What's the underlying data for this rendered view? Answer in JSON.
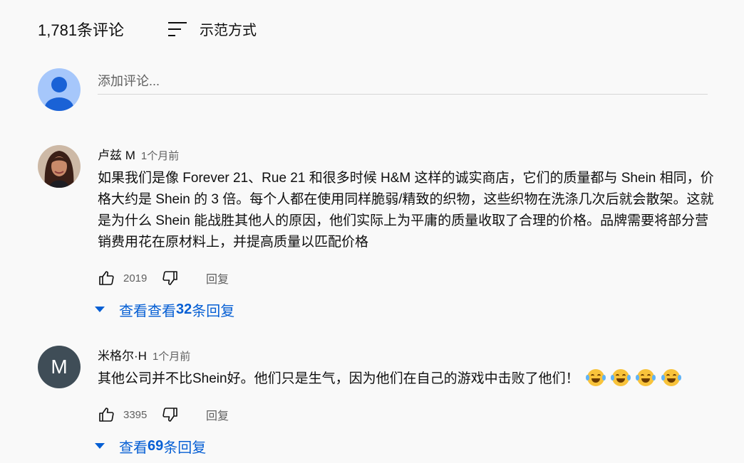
{
  "header": {
    "comment_count": "1,781条评论",
    "sort_label": "示范方式"
  },
  "add_comment": {
    "placeholder": "添加评论..."
  },
  "comments": [
    {
      "author": "卢兹 M",
      "time": "1个月前",
      "text": "如果我们是像 Forever 21、Rue 21 和很多时候 H&M 这样的诚实商店，它们的质量都与 Shein 相同，价格大约是 Shein 的 3 倍。每个人都在使用同样脆弱/精致的织物，这些织物在洗涤几次后就会散架。这就是为什么 Shein 能战胜其他人的原因，他们实际上为平庸的质量收取了合理的价格。品牌需要将部分营销费用花在原材料上，并提高质量以匹配价格",
      "likes": "2019",
      "reply_label": "回复",
      "replies_prefix": "查看查看",
      "replies_count": "32",
      "replies_suffix": "条回复"
    },
    {
      "author": "米格尔·H",
      "time": "1个月前",
      "avatar_letter": "M",
      "text": "其他公司并不比Shein好。他们只是生气，因为他们在自己的游戏中击败了他们！",
      "emoji_count": 4,
      "likes": "3395",
      "reply_label": "回复",
      "replies_prefix": "查看",
      "replies_count": "69",
      "replies_suffix": "条回复"
    }
  ],
  "colors": {
    "link_blue": "#065fd4",
    "default_avatar": "#a6c7fb",
    "letter_avatar": "#3f4d57"
  }
}
